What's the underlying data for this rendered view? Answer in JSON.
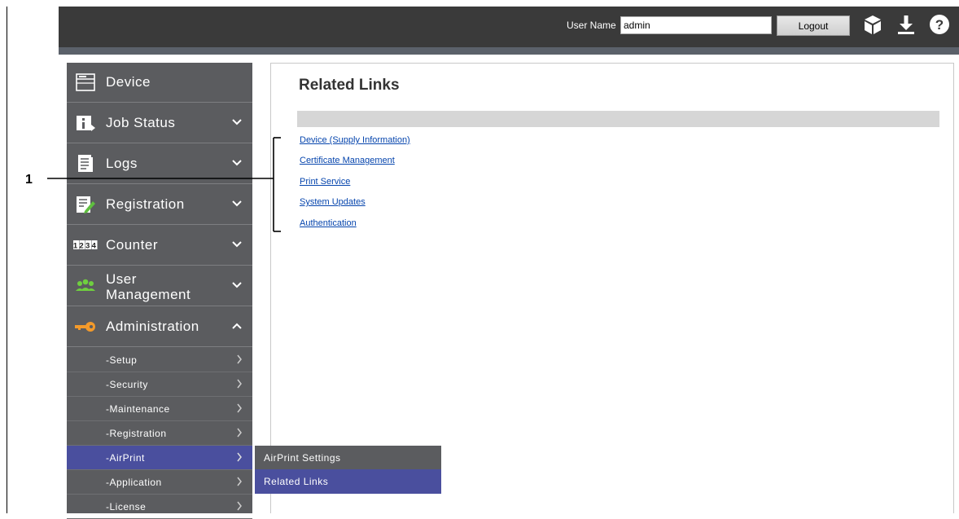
{
  "header": {
    "user_name_label": "User Name",
    "user_name_value": "admin",
    "logout_label": "Logout"
  },
  "sidebar": {
    "items": [
      {
        "label": "Device",
        "icon": "device-icon"
      },
      {
        "label": "Job Status",
        "icon": "job-status-icon"
      },
      {
        "label": "Logs",
        "icon": "logs-icon"
      },
      {
        "label": "Registration",
        "icon": "registration-icon"
      },
      {
        "label": "Counter",
        "icon": "counter-icon"
      },
      {
        "label": "User Management",
        "label_line1": "User",
        "label_line2": "Management",
        "icon": "users-icon"
      },
      {
        "label": "Administration",
        "icon": "key-icon"
      }
    ],
    "sub_items": [
      {
        "label": "-Setup"
      },
      {
        "label": "-Security"
      },
      {
        "label": "-Maintenance"
      },
      {
        "label": "-Registration"
      },
      {
        "label": "-AirPrint",
        "active": true
      },
      {
        "label": "-Application"
      },
      {
        "label": "-License"
      }
    ],
    "counter_digits": "1234"
  },
  "flyout": {
    "items": [
      {
        "label": "AirPrint Settings"
      },
      {
        "label": "Related Links",
        "active": true
      }
    ]
  },
  "content": {
    "title": "Related Links",
    "links": [
      "Device (Supply Information)",
      "Certificate Management",
      "Print Service",
      "System Updates",
      "Authentication"
    ]
  },
  "annotation": {
    "callout_number": "1"
  },
  "colors": {
    "topbar": "#3a3a3a",
    "sidebar": "#5b5c5f",
    "active_item": "#4a4f9e",
    "flyout_header": "#5b5c5f",
    "link": "#0645ad"
  }
}
